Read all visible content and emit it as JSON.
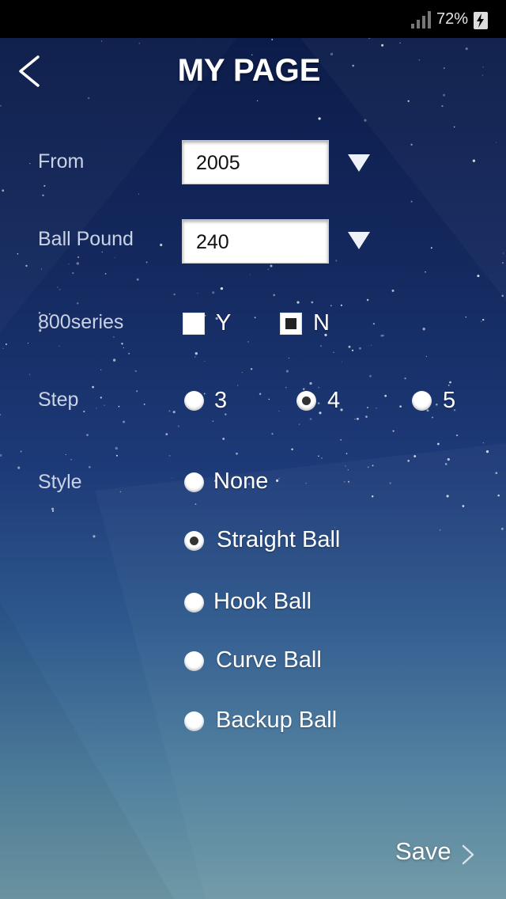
{
  "status_bar": {
    "battery_percent": "72%"
  },
  "header": {
    "title": "MY PAGE"
  },
  "form": {
    "from": {
      "label": "From",
      "value": "2005"
    },
    "ball_pound": {
      "label": "Ball Pound",
      "value": "240"
    },
    "series800": {
      "label": "800series",
      "options": [
        "Y",
        "N"
      ],
      "selected": "N"
    },
    "step": {
      "label": "Step",
      "options": [
        "3",
        "4",
        "5"
      ],
      "selected": "4"
    },
    "style": {
      "label": "Style",
      "options": [
        "None",
        "Straight Ball",
        "Hook Ball",
        "Curve Ball",
        "Backup Ball"
      ],
      "selected": "Straight Ball"
    }
  },
  "footer": {
    "save_label": "Save"
  },
  "icons": [
    "back-icon",
    "dropdown-arrow-icon",
    "chevron-right-icon",
    "signal-icon",
    "battery-charging-icon"
  ]
}
